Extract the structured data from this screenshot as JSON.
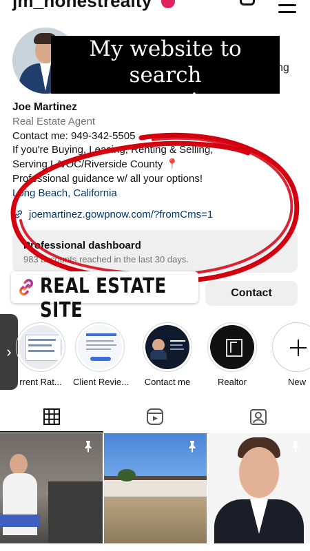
{
  "header": {
    "username": "jm_honestrealty",
    "icons": [
      "add-post-icon",
      "menu-icon"
    ]
  },
  "overlay_banner": {
    "line1": "My website to search",
    "line2": "properties"
  },
  "stats_fragment": "ng",
  "bio": {
    "name": "Joe Martinez",
    "category": "Real Estate Agent",
    "lines": [
      "Contact me: 949-342-5505",
      "If you're Buying, Leasing, Renting & Selling,",
      "Serving LA/OC/Riverside County 📍",
      "Professional guidance w/ all your options!"
    ],
    "location": "Long Beach, California",
    "link": "joemartinez.gowpnow.com/?fromCms=1"
  },
  "dashboard": {
    "title": "Professional dashboard",
    "subtitle": "983 accounts reached in the last 30 days."
  },
  "sticker": {
    "label": "REAL ESTATE SITE"
  },
  "buttons": {
    "contact": "Contact"
  },
  "highlights": [
    {
      "label": "rrent Rat..."
    },
    {
      "label": "Client Revie..."
    },
    {
      "label": "Contact me"
    },
    {
      "label": "Realtor"
    },
    {
      "label": "New"
    }
  ],
  "tabs": [
    "grid-tab",
    "reels-tab",
    "tagged-tab"
  ],
  "colors": {
    "annotation_red": "#d4000f",
    "link_blue": "#00376b",
    "secondary_gray": "#737373",
    "button_gray": "#efefef"
  }
}
